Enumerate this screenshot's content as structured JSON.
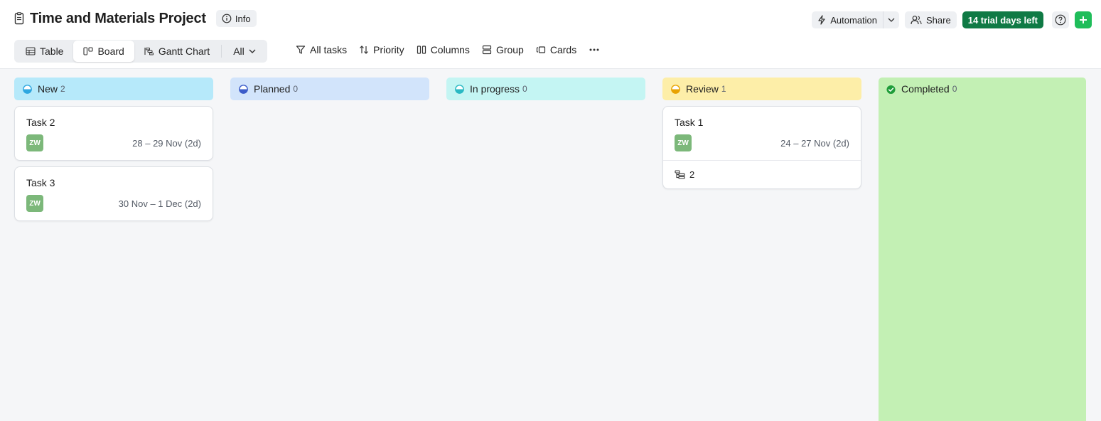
{
  "header": {
    "title": "Time and Materials Project",
    "info_label": "Info",
    "automation_label": "Automation",
    "share_label": "Share",
    "trial_label": "14 trial days left"
  },
  "views": {
    "tabs": [
      {
        "label": "Table",
        "icon": "table-icon"
      },
      {
        "label": "Board",
        "icon": "board-icon",
        "active": true
      },
      {
        "label": "Gantt Chart",
        "icon": "gantt-icon"
      }
    ],
    "filter_scope": "All"
  },
  "toolbar": {
    "all_tasks": "All tasks",
    "priority": "Priority",
    "columns": "Columns",
    "group": "Group",
    "cards": "Cards"
  },
  "columns": [
    {
      "name": "New",
      "count": "2",
      "bg": "#b6e9fa",
      "dot": "#2ea7e0",
      "cards": [
        {
          "title": "Task 2",
          "assignee": "ZW",
          "dates": "28 – 29 Nov (2d)"
        },
        {
          "title": "Task 3",
          "assignee": "ZW",
          "dates": "30 Nov – 1 Dec (2d)"
        }
      ]
    },
    {
      "name": "Planned",
      "count": "0",
      "bg": "#d2e4fb",
      "dot": "#3c5cc9",
      "cards": []
    },
    {
      "name": "In progress",
      "count": "0",
      "bg": "#c4f5f3",
      "dot": "#29b9c3",
      "cards": []
    },
    {
      "name": "Review",
      "count": "1",
      "bg": "#fdeea8",
      "dot": "#e8a200",
      "cards": [
        {
          "title": "Task 1",
          "assignee": "ZW",
          "dates": "24 – 27 Nov (2d)",
          "subtasks": "2"
        }
      ]
    },
    {
      "name": "Completed",
      "count": "0",
      "bg": "#c3f0b4",
      "dot": "#1f9d3a",
      "cards": []
    }
  ],
  "colors": {
    "accent_green": "#0f7a45",
    "add_button": "#1fbd5a"
  }
}
